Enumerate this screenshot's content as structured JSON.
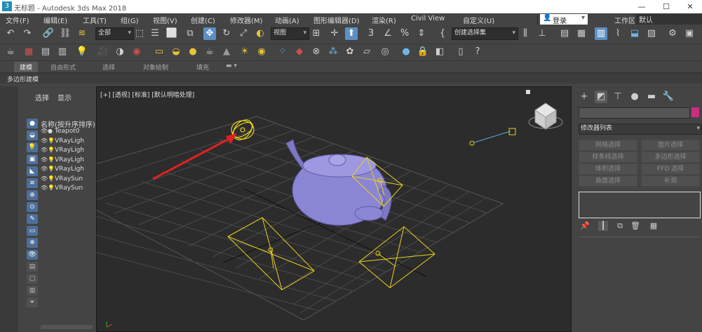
{
  "window": {
    "title": "无标题 - Autodesk 3ds Max 2018",
    "app_icon_glyph": "3",
    "minimize": "—",
    "maximize": "☐",
    "close": "✕"
  },
  "menubar": {
    "items": [
      "文件(F)",
      "编辑(E)",
      "工具(T)",
      "组(G)",
      "视图(V)",
      "创建(C)",
      "修改器(M)",
      "动画(A)",
      "图形编辑器(D)",
      "渲染(R)",
      "Civil View",
      "自定义(U)"
    ],
    "login_label": "登录",
    "workspace_label": "工作区:",
    "workspace_value": "默认"
  },
  "toolbar1": {
    "selection_filter": "全部",
    "ref_coord": "视图",
    "named_selection": "创建选择集"
  },
  "ribbon": {
    "tabs": [
      "建模",
      "自由形式",
      "选择",
      "对象绘制",
      "填充"
    ],
    "active_tab": "建模",
    "sub_label": "多边形建模"
  },
  "scene_explorer": {
    "tab_select": "选择",
    "tab_display": "显示",
    "column_header": "名称(按升序排序)",
    "rows": [
      {
        "name": "Teapot0",
        "type": "geometry"
      },
      {
        "name": "VRayLigh",
        "type": "light"
      },
      {
        "name": "VRayLigh",
        "type": "light"
      },
      {
        "name": "VRayLigh",
        "type": "light"
      },
      {
        "name": "VRayLigh",
        "type": "light"
      },
      {
        "name": "VRaySun",
        "type": "light"
      },
      {
        "name": "VRaySun",
        "type": "light"
      }
    ]
  },
  "viewport": {
    "label": "[+] [透视] [标准] [默认明暗处理]",
    "teapot_color": "#8b86d4",
    "light_color": "#e8d020",
    "arrow_color": "#e02020"
  },
  "command_panel": {
    "modifier_list": "修改器列表",
    "buttons": [
      "网格选择",
      "面片选择",
      "样条线选择",
      "多边形选择",
      "体积选择",
      "FFD 选择",
      "曲面选择",
      "补洞"
    ],
    "color_swatch": "#cc2d82"
  }
}
